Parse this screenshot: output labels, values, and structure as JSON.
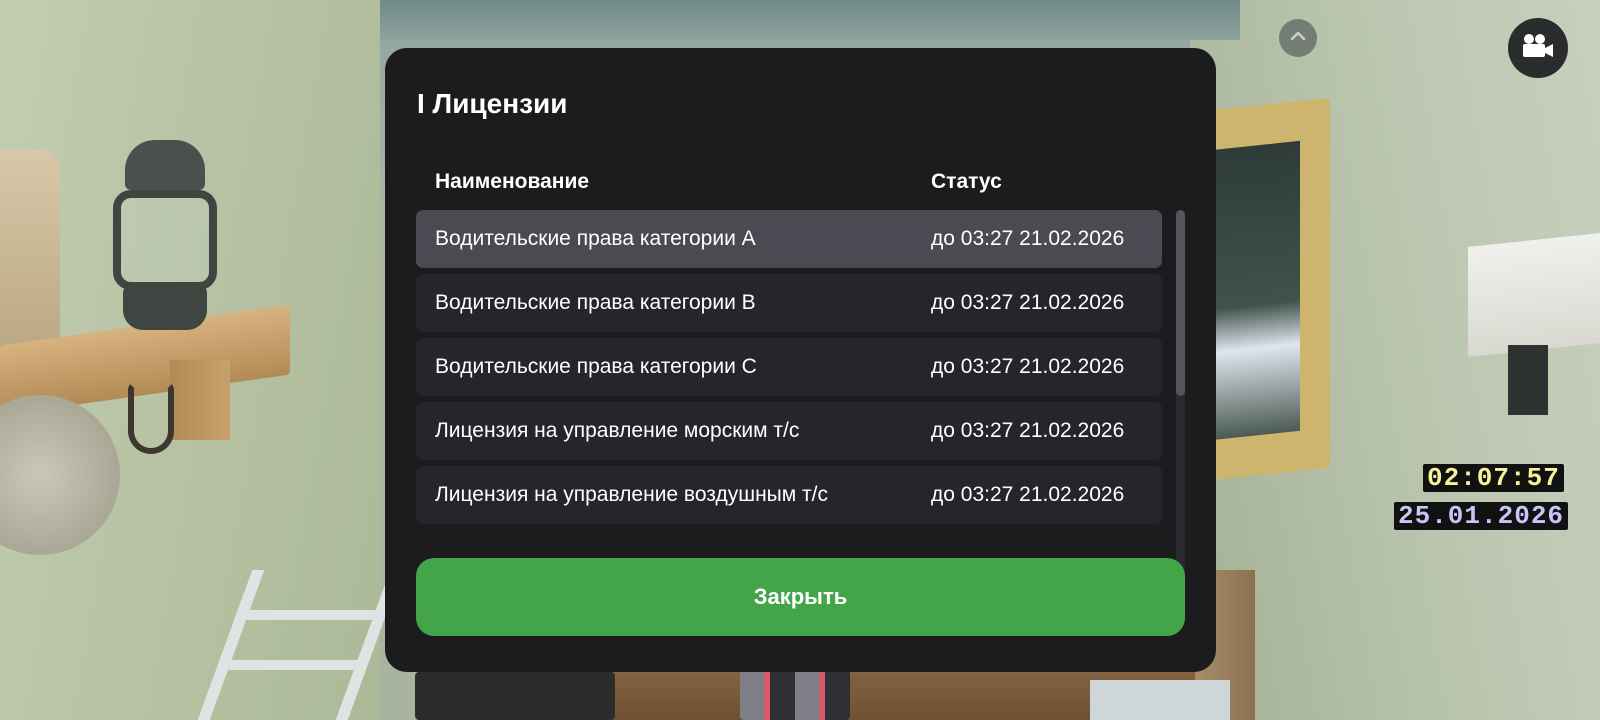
{
  "modal": {
    "title": "I Лицензии",
    "columns": {
      "name": "Наименование",
      "status": "Статус"
    },
    "rows": [
      {
        "name": "Водительские права категории A",
        "status": "до 03:27 21.02.2026",
        "selected": true
      },
      {
        "name": "Водительские права категории B",
        "status": "до 03:27 21.02.2026",
        "selected": false
      },
      {
        "name": "Водительские права категории C",
        "status": "до 03:27 21.02.2026",
        "selected": false
      },
      {
        "name": "Лицензия на управление морским т/с",
        "status": "до 03:27 21.02.2026",
        "selected": false
      },
      {
        "name": "Лицензия на управление воздушным т/с",
        "status": "до 03:27 21.02.2026",
        "selected": false
      }
    ],
    "close_label": "Закрыть"
  },
  "hud": {
    "time": "02:07:57",
    "date": "25.01.2026",
    "collapse_icon": "chevron-up-icon",
    "camera_icon": "video-camera-icon"
  },
  "colors": {
    "panel": "#1c1c1f",
    "row": "#26262a",
    "row_selected": "#4a4a52",
    "accent_green": "#44a548",
    "hud_time": "#f6f19a",
    "hud_date": "#c8c4f8"
  }
}
